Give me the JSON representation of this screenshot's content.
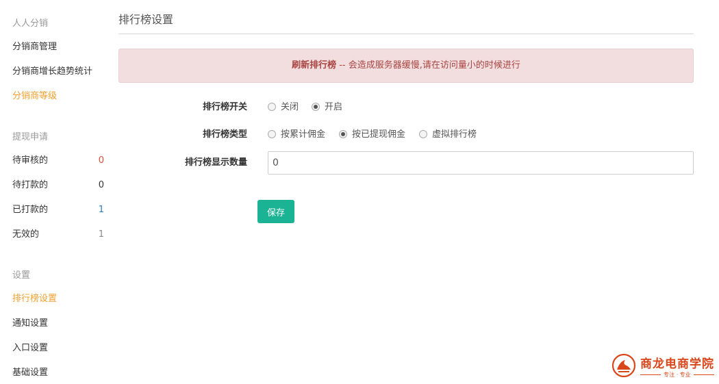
{
  "sidebar": {
    "sections": [
      {
        "title": "人人分销",
        "items": [
          {
            "label": "分销商管理"
          },
          {
            "label": "分销商增长趋势统计"
          },
          {
            "label": "分销商等级"
          }
        ]
      },
      {
        "title": "提现申请",
        "items": [
          {
            "label": "待审核的",
            "count": "0"
          },
          {
            "label": "待打款的",
            "count": "0"
          },
          {
            "label": "已打款的",
            "count": "1"
          },
          {
            "label": "无效的",
            "count": "1"
          }
        ]
      },
      {
        "title": "设置",
        "items": [
          {
            "label": "排行榜设置"
          },
          {
            "label": "通知设置"
          },
          {
            "label": "入口设置"
          },
          {
            "label": "基础设置"
          }
        ]
      }
    ],
    "active_color": "#f0a030",
    "count_colors": [
      "#e04c3c",
      "#333333",
      "#2a7ac0",
      "#888888"
    ]
  },
  "main": {
    "title": "排行榜设置",
    "alert": {
      "strong": "刷新排行榜",
      "text": " -- 会造成服务器缓慢,请在访问量小的时候进行"
    },
    "form": {
      "switch": {
        "label": "排行榜开关",
        "options": [
          "关闭",
          "开启"
        ],
        "selected": "开启"
      },
      "type": {
        "label": "排行榜类型",
        "options": [
          "按累计佣金",
          "按已提现佣金",
          "虚拟排行榜"
        ],
        "selected": "按已提现佣金"
      },
      "count": {
        "label": "排行榜显示数量",
        "value": "0"
      }
    },
    "save_label": "保存"
  },
  "watermark": {
    "title": "商龙电商学院",
    "subtitle": "专注 · 专业"
  },
  "colors": {
    "primary": "#1ab394",
    "alert_bg": "#f2dede",
    "alert_text": "#a94442"
  }
}
